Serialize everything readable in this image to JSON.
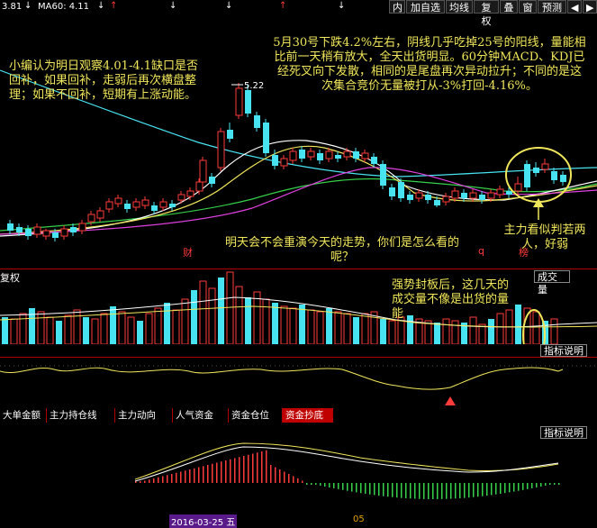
{
  "toolbar": {
    "ma_a_value": "3.81",
    "ma60_label": "MA60: 4.11",
    "buttons": [
      "内",
      "加自选",
      "均线",
      "复权",
      "叠",
      "窗",
      "预测"
    ]
  },
  "price_chart": {
    "high_marker": "5.22",
    "mark_cai": "财",
    "mark_q": "q",
    "mark_bang": "榜"
  },
  "notes": {
    "left": "小编认为明日观察4.01-4.1缺口是否回补，如果回补，走弱后再次横盘整理；如果不回补，短期有上涨动能。",
    "top_right": "5月30号下跌4.2%左右，阴线几乎吃掉25号的阳线，量能相比前一天稍有放大，全天出货明显。60分钟MACD、KDJ已经死叉向下发散，相同的是尾盘再次异动拉升；不同的是这次集合竞价无量被打从-3%打回-4.16%。",
    "question": "明天会不会重演今天的走势，你们是怎么看的呢？",
    "main_force": "主力看似判若两人，好弱",
    "volume_note": "强势封板后，这几天的成交量不像是出货的量能"
  },
  "volume_panel": {
    "left_label": "复权",
    "right_label": "成交量"
  },
  "indicator_panel": {
    "explain_label": "指标说明"
  },
  "tabs": [
    "大单金额",
    "主力持仓线",
    "主力动向",
    "人气资金",
    "资金仓位",
    "资金抄底"
  ],
  "active_tab": "资金抄底",
  "macd_panel": {
    "explain_label": "指标说明"
  },
  "bottom": {
    "date_label": "2016-03-25 五",
    "month_label": "05"
  },
  "colors": {
    "up": "#ff3b3b",
    "down": "#47e3f0",
    "note": "#f0e65a",
    "separator": "#b00000",
    "highlight_circle": "#f0e65a"
  }
}
